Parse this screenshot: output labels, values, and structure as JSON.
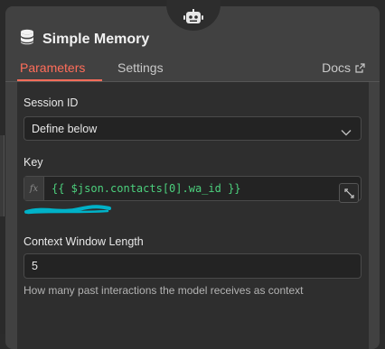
{
  "node": {
    "title": "Simple Memory",
    "title_icon": "database-icon",
    "bubble_icon": "robot-icon"
  },
  "tabs": [
    {
      "label": "Parameters",
      "active": true
    },
    {
      "label": "Settings",
      "active": false
    }
  ],
  "docs": {
    "label": "Docs",
    "icon": "external-link-icon"
  },
  "session_id": {
    "label": "Session ID",
    "value": "Define below"
  },
  "key": {
    "label": "Key",
    "prefix": "fx",
    "expression": "{{ $json.contacts[0].wa_id }}"
  },
  "context_window": {
    "label": "Context Window Length",
    "value": "5",
    "hint": "How many past interactions the model receives as context"
  },
  "colors": {
    "accent": "#ff6d5a",
    "expression": "#4cd07d",
    "scribble": "#00b2c8"
  }
}
